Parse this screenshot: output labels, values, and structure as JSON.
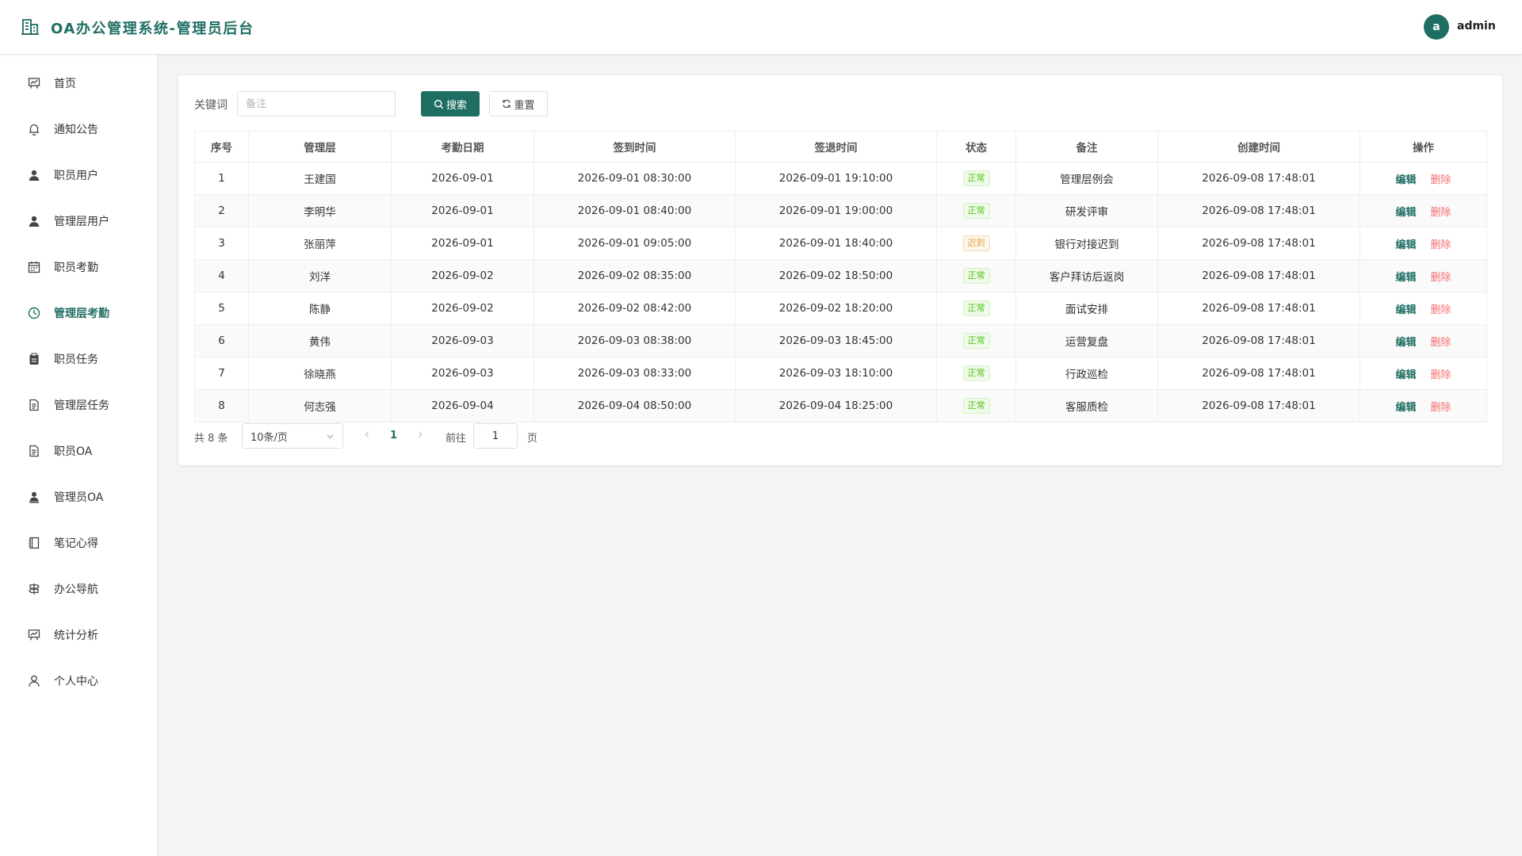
{
  "header": {
    "title": "OA办公管理系统-管理员后台",
    "avatar_letter": "a",
    "username": "admin"
  },
  "sidebar": {
    "items": [
      {
        "label": "首页",
        "icon": "chart-board-icon"
      },
      {
        "label": "通知公告",
        "icon": "bell-icon"
      },
      {
        "label": "职员用户",
        "icon": "user-filled-icon"
      },
      {
        "label": "管理层用户",
        "icon": "user-filled-icon"
      },
      {
        "label": "职员考勤",
        "icon": "calendar-icon"
      },
      {
        "label": "管理层考勤",
        "icon": "clock-icon",
        "active": true
      },
      {
        "label": "职员任务",
        "icon": "clipboard-icon"
      },
      {
        "label": "管理层任务",
        "icon": "document-icon"
      },
      {
        "label": "职员OA",
        "icon": "document-icon"
      },
      {
        "label": "管理员OA",
        "icon": "avatar-icon"
      },
      {
        "label": "笔记心得",
        "icon": "notebook-icon"
      },
      {
        "label": "办公导航",
        "icon": "guide-icon"
      },
      {
        "label": "统计分析",
        "icon": "chart-board-icon"
      },
      {
        "label": "个人中心",
        "icon": "user-outline-icon"
      }
    ]
  },
  "search": {
    "label": "关键词",
    "placeholder": "备注",
    "value": "",
    "search_button": "搜索",
    "reset_button": "重置"
  },
  "table": {
    "headers": [
      "序号",
      "管理层",
      "考勤日期",
      "签到时间",
      "签退时间",
      "状态",
      "备注",
      "创建时间",
      "操作"
    ],
    "rows": [
      {
        "no": "1",
        "name": "王建国",
        "date": "2026-09-01",
        "checkin": "2026-09-01 08:30:00",
        "checkout": "2026-09-01 19:10:00",
        "status": "正常",
        "status_type": "normal",
        "remark": "管理层例会",
        "created": "2026-09-08 17:48:01"
      },
      {
        "no": "2",
        "name": "李明华",
        "date": "2026-09-01",
        "checkin": "2026-09-01 08:40:00",
        "checkout": "2026-09-01 19:00:00",
        "status": "正常",
        "status_type": "normal",
        "remark": "研发评审",
        "created": "2026-09-08 17:48:01"
      },
      {
        "no": "3",
        "name": "张丽萍",
        "date": "2026-09-01",
        "checkin": "2026-09-01 09:05:00",
        "checkout": "2026-09-01 18:40:00",
        "status": "迟到",
        "status_type": "late",
        "remark": "银行对接迟到",
        "created": "2026-09-08 17:48:01"
      },
      {
        "no": "4",
        "name": "刘洋",
        "date": "2026-09-02",
        "checkin": "2026-09-02 08:35:00",
        "checkout": "2026-09-02 18:50:00",
        "status": "正常",
        "status_type": "normal",
        "remark": "客户拜访后返岗",
        "created": "2026-09-08 17:48:01"
      },
      {
        "no": "5",
        "name": "陈静",
        "date": "2026-09-02",
        "checkin": "2026-09-02 08:42:00",
        "checkout": "2026-09-02 18:20:00",
        "status": "正常",
        "status_type": "normal",
        "remark": "面试安排",
        "created": "2026-09-08 17:48:01"
      },
      {
        "no": "6",
        "name": "黄伟",
        "date": "2026-09-03",
        "checkin": "2026-09-03 08:38:00",
        "checkout": "2026-09-03 18:45:00",
        "status": "正常",
        "status_type": "normal",
        "remark": "运营复盘",
        "created": "2026-09-08 17:48:01"
      },
      {
        "no": "7",
        "name": "徐晓燕",
        "date": "2026-09-03",
        "checkin": "2026-09-03 08:33:00",
        "checkout": "2026-09-03 18:10:00",
        "status": "正常",
        "status_type": "normal",
        "remark": "行政巡检",
        "created": "2026-09-08 17:48:01"
      },
      {
        "no": "8",
        "name": "何志强",
        "date": "2026-09-04",
        "checkin": "2026-09-04 08:50:00",
        "checkout": "2026-09-04 18:25:00",
        "status": "正常",
        "status_type": "normal",
        "remark": "客服质检",
        "created": "2026-09-08 17:48:01"
      }
    ],
    "edit_label": "编辑",
    "delete_label": "删除"
  },
  "pagination": {
    "total_text": "共 8 条",
    "page_size": "10条/页",
    "current_page": "1",
    "goto_label": "前往",
    "goto_value": "1",
    "page_unit": "页"
  },
  "colors": {
    "brand": "#1f6e63",
    "danger": "#f56c6c",
    "status_normal": "#52c41a",
    "status_late": "#e6a23c"
  }
}
